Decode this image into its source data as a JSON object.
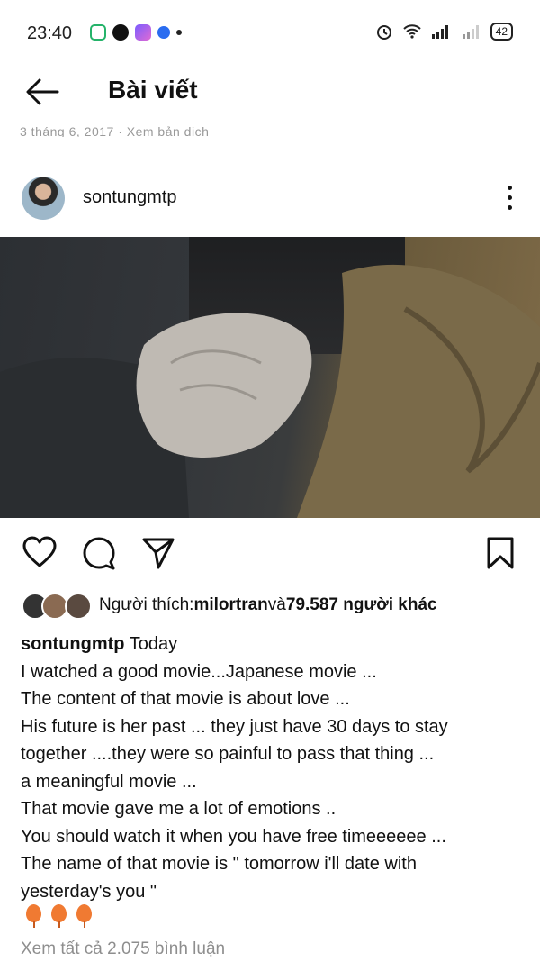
{
  "status_bar": {
    "time": "23:40",
    "battery": "42"
  },
  "header": {
    "title": "Bài viết"
  },
  "prev_meta": {
    "faded_text": "3 tháng 6, 2017 · Xem bản dịch"
  },
  "post": {
    "username": "sontungmtp",
    "likes": {
      "prefix": "Người thích: ",
      "first_user": "milortran",
      "joiner": " và ",
      "others": "79.587 người khác"
    },
    "caption": {
      "user": "sontungmtp",
      "lines": [
        " Today",
        "I watched a good movie...Japanese movie ...",
        "The content of that movie is about love ...",
        "His future is her past ... they just have 30 days to stay",
        "together ....they were so painful to pass that thing ...",
        "a meaningful movie ...",
        "That movie gave me a lot of emotions ..",
        "You should watch it when you have free timeeeeee ...",
        "The name of that movie is \" tomorrow i'll date with",
        "yesterday's you \""
      ]
    },
    "comments_link": "Xem tất cả 2.075 bình luận"
  },
  "icons": {
    "back": "back-arrow-icon",
    "more": "more-vertical-icon",
    "like": "heart-icon",
    "comment": "comment-icon",
    "share": "send-icon",
    "save": "bookmark-icon",
    "emoji": "balloon-icon"
  }
}
